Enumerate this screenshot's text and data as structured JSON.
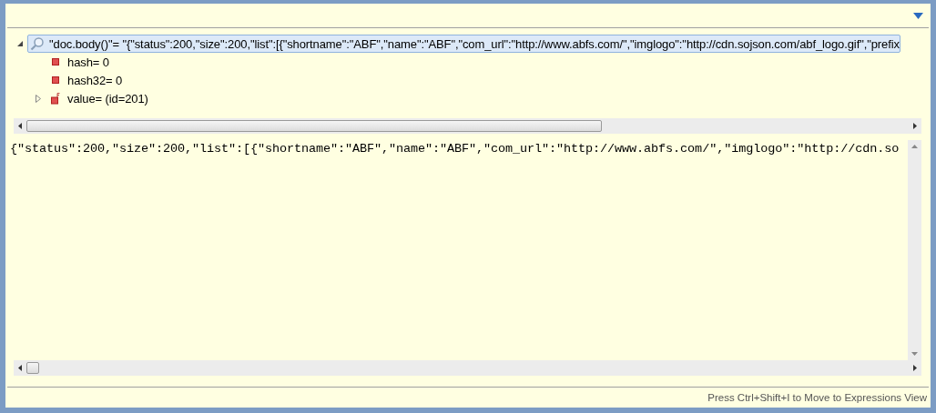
{
  "tree": [
    {
      "label": "\"doc.body()\"= \"{\"status\":200,\"size\":200,\"list\":[{\"shortname\":\"ABF\",\"name\":\"ABF\",\"com_url\":\"http://www.abfs.com/\",\"imglogo\":\"http://cdn.sojson.com/abf_logo.gif\",\"prefix",
      "kind": "expression",
      "selected": true,
      "expanded": true,
      "children": [
        {
          "label": "hash= 0",
          "kind": "field",
          "selected": false
        },
        {
          "label": "hash32= 0",
          "kind": "field",
          "selected": false
        },
        {
          "label": "value=  (id=201)",
          "kind": "final-field",
          "selected": false,
          "expanded": false
        }
      ]
    }
  ],
  "detail_text": "{\"status\":200,\"size\":200,\"list\":[{\"shortname\":\"ABF\",\"name\":\"ABF\",\"com_url\":\"http://www.abfs.com/\",\"imglogo\":\"http://cdn.so",
  "status_bar": "Press Ctrl+Shift+I to Move to Expressions View"
}
